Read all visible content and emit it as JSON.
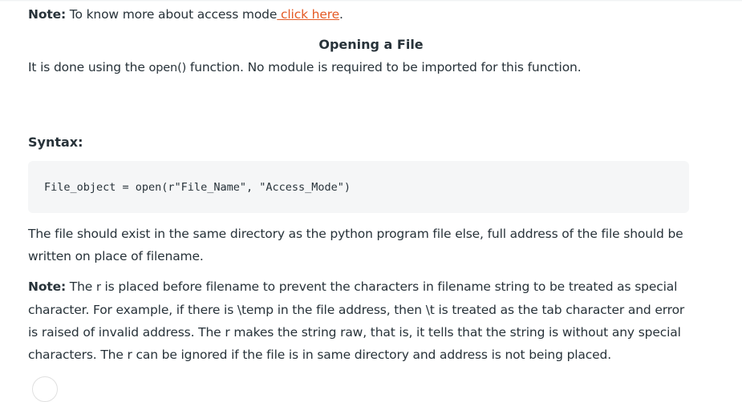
{
  "note1": {
    "label": "Note:",
    "text": " To know more about access mode",
    "link": " click here",
    "end": "."
  },
  "heading": "Opening a File",
  "intro": {
    "before": "It is done using the ",
    "code": "open()",
    "after": " function. No module is required to be imported for this function."
  },
  "syntax_label": "Syntax:",
  "code": "File_object = open(r\"File_Name\", \"Access_Mode\")",
  "para2": "The file should exist in the same directory as the python program file else, full address of the file should be written on place of filename.",
  "note2": {
    "label": "Note:",
    "before": " The ",
    "code": "r",
    "after": " is placed before filename to prevent the characters in filename string to be treated as special character. For example, if there is \\temp in the file address, then \\t is treated as the tab character and error is raised of invalid address. The r makes the string raw, that is, it tells that the string is without any special characters. The r can be ignored if the file is in same directory and address is not being placed."
  },
  "colors": {
    "link": "#e45a25",
    "text": "#273239",
    "code_bg": "#f5f6f7"
  }
}
